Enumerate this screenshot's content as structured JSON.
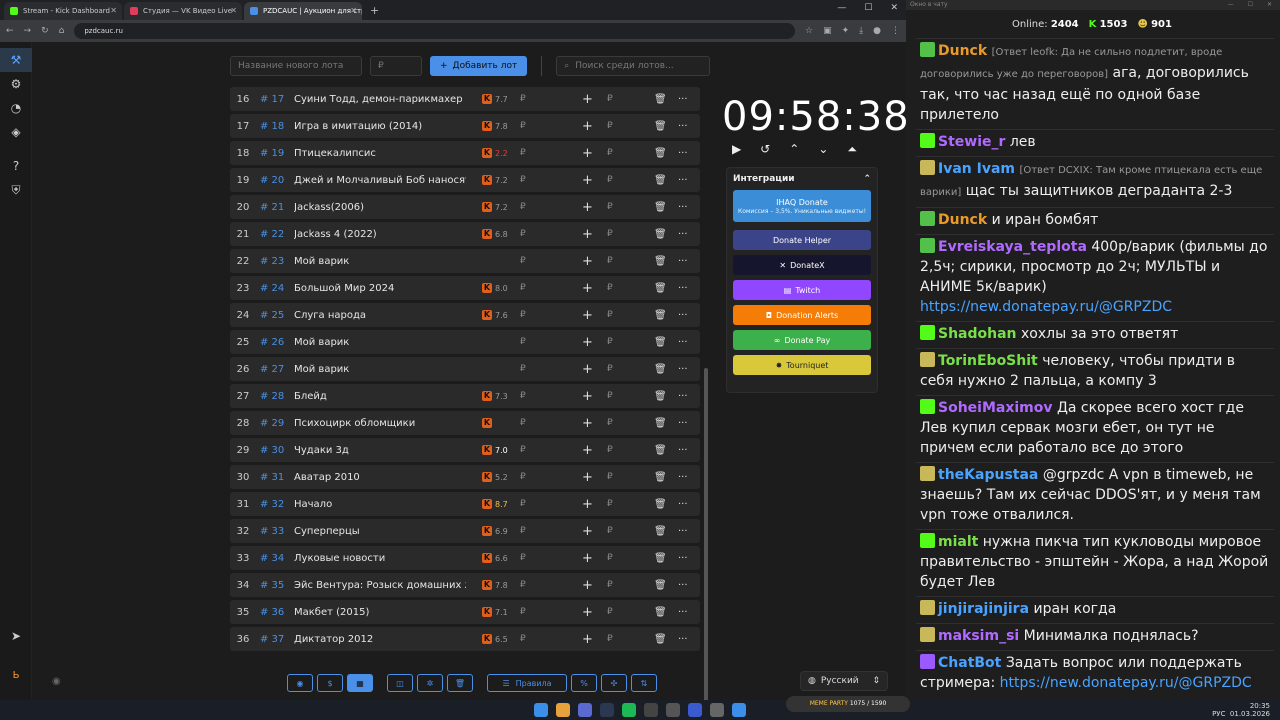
{
  "browser": {
    "tabs": [
      {
        "title": "Stream - Kick Dashboard",
        "color": "#53fc18"
      },
      {
        "title": "Студия — VK Видео Live",
        "color": "#e23c5b"
      },
      {
        "title": "PZDCAUC | Аукцион для стри",
        "color": "#4a8fe8"
      }
    ],
    "url": "pzdcauc.ru"
  },
  "sidebar": {
    "icons": [
      "auction-icon",
      "gear-icon",
      "pie-icon",
      "layers-icon",
      "help-icon",
      "shield-icon",
      "telegram-icon",
      "boosty-icon"
    ]
  },
  "controls": {
    "lot_placeholder": "Название нового лота",
    "amount_placeholder": "₽",
    "add_label": "Добавить лот",
    "search_placeholder": "Поиск среди лотов..."
  },
  "lots": [
    {
      "n": "16",
      "id": "# 17",
      "name": "Суини Тодд, демон-парикмахер с Ф",
      "rating": "7.7"
    },
    {
      "n": "17",
      "id": "# 18",
      "name": "Игра в имитацию (2014)",
      "rating": "7.8"
    },
    {
      "n": "18",
      "id": "# 19",
      "name": "Птицекалипсис",
      "rating": "2.2"
    },
    {
      "n": "19",
      "id": "# 20",
      "name": "Джей и Молчаливый Боб наносят о",
      "rating": "7.2"
    },
    {
      "n": "20",
      "id": "# 21",
      "name": "Jackass(2006)",
      "rating": "7.2"
    },
    {
      "n": "21",
      "id": "# 22",
      "name": "Jackass 4 (2022)",
      "rating": "6.8"
    },
    {
      "n": "22",
      "id": "# 23",
      "name": "Мой варик",
      "rating": ""
    },
    {
      "n": "23",
      "id": "# 24",
      "name": "Большой Мир 2024",
      "rating": "8.0"
    },
    {
      "n": "24",
      "id": "# 25",
      "name": "Слуга народа",
      "rating": "7.6"
    },
    {
      "n": "25",
      "id": "# 26",
      "name": "Мой варик",
      "rating": ""
    },
    {
      "n": "26",
      "id": "# 27",
      "name": "Мой варик",
      "rating": ""
    },
    {
      "n": "27",
      "id": "# 28",
      "name": "Блейд",
      "rating": "7.3"
    },
    {
      "n": "28",
      "id": "# 29",
      "name": "Психоцирк обломщики",
      "rating": ""
    },
    {
      "n": "29",
      "id": "# 30",
      "name": "Чудаки 3д",
      "rating": "7.0"
    },
    {
      "n": "30",
      "id": "# 31",
      "name": "Аватар 2010",
      "rating": "5.2"
    },
    {
      "n": "31",
      "id": "# 32",
      "name": "Начало",
      "rating": "8.7"
    },
    {
      "n": "32",
      "id": "# 33",
      "name": "Суперперцы",
      "rating": "6.9"
    },
    {
      "n": "33",
      "id": "# 34",
      "name": "Луковые новости",
      "rating": "6.6"
    },
    {
      "n": "34",
      "id": "# 35",
      "name": "Эйс Вентура: Розыск домашних жи",
      "rating": "7.8"
    },
    {
      "n": "35",
      "id": "# 36",
      "name": "Макбет (2015)",
      "rating": "7.1"
    },
    {
      "n": "36",
      "id": "# 37",
      "name": "Диктатор 2012",
      "rating": "6.5"
    }
  ],
  "timer": "09:58:38",
  "integrations": {
    "title": "Интеграции",
    "buttons": [
      {
        "label": "IHAQ Donate",
        "sub": "Комиссия – 3,5%. Уникальные виджеты!",
        "color": "#3a8dd6"
      },
      {
        "label": "Donate Helper",
        "color": "#3b4489"
      },
      {
        "label": "DonateX",
        "color": "#15162e"
      },
      {
        "label": "Twitch",
        "color": "#9146ff"
      },
      {
        "label": "Donation Alerts",
        "color": "#f57d07"
      },
      {
        "label": "Donate Pay",
        "color": "#3cb04a"
      },
      {
        "label": "Tourniquet",
        "color": "#d9c83a"
      }
    ]
  },
  "bottom": {
    "rules_label": "Правила",
    "language": "Русский"
  },
  "chat": {
    "window_title": "Окно в чату",
    "online_label": "Online:",
    "online": "2404",
    "kick_count": "1503",
    "other_count": "901",
    "messages": [
      {
        "user": "Dunck",
        "color": "#e89a2a",
        "badge": "#53c04a",
        "reply": "[Ответ leofk: Да не сильно подлетит, вроде договорились уже до переговоров]",
        "text": "ага, договорились так, что час назад ещё по одной базе прилетело"
      },
      {
        "user": "Stewie_r",
        "color": "#b06aff",
        "badge": "#53fc18",
        "reply": "",
        "text": "лев"
      },
      {
        "user": "Ivan Ivam",
        "color": "#4aa3ff",
        "badge": "#c8b85a",
        "reply": "[Ответ DCXIX: Там кроме птицекала есть еще варики]",
        "text": "щас ты защитников деграданта 2-3"
      },
      {
        "user": "Dunck",
        "color": "#e89a2a",
        "badge": "#53c04a",
        "reply": "",
        "text": "и иран бомбят"
      },
      {
        "user": "Evreiskaya_teplota",
        "color": "#b06aff",
        "badge": "#53c04a",
        "reply": "",
        "text": "400р/варик (фильмы до 2,5ч; сирики, просмотр до 2ч; МУЛЬТЫ и АНИМЕ 5к/варик)",
        "link": "https://new.donatepay.ru/@GRPZDC"
      },
      {
        "user": "Shadohan",
        "color": "#7ae04a",
        "badge": "#53fc18",
        "reply": "",
        "text": "хохлы за это ответят"
      },
      {
        "user": "TorinEboShit",
        "color": "#7ae04a",
        "badge": "#c8b85a",
        "reply": "",
        "text": "человеку, чтобы придти в себя нужно 2 пальца, а компу 3"
      },
      {
        "user": "SoheiMaximov",
        "color": "#b06aff",
        "badge": "#53fc18",
        "reply": "",
        "text": "Да скорее всего хост где Лев купил сервак мозги ебет, он тут не причем если работало все до этого"
      },
      {
        "user": "theKapustaa",
        "color": "#4aa3ff",
        "badge": "#c8b85a",
        "reply": "",
        "text": "@grpzdc А vpn в timeweb, не знаешь? Там их сейчас DDOS'ят, и у меня там vpn тоже отвалился."
      },
      {
        "user": "mialt",
        "color": "#7ae04a",
        "badge": "#53fc18",
        "reply": "",
        "text": "нужна пикча тип кукловоды мировое правительство - эпштейн - Жора, а над Жорой будет Лев"
      },
      {
        "user": "jinjirajinjira",
        "color": "#4aa3ff",
        "badge": "#c8b85a",
        "reply": "",
        "text": "иран когда"
      },
      {
        "user": "maksim_si",
        "color": "#b06aff",
        "badge": "#c8b85a",
        "reply": "",
        "text": "Минималка поднялась?"
      },
      {
        "user": "ChatBot",
        "color": "#4aa3ff",
        "badge": "#9a5aff",
        "reply": "",
        "text": "Задать вопрос или поддержать стримера:",
        "link": "https://new.donatepay.ru/@GRPZDC"
      }
    ]
  },
  "taskbar": {
    "lang": "РУС",
    "time": "20:35",
    "date": "01.03.2026",
    "meme": "MEME PARTY",
    "meme_count": "1075 / 1590"
  }
}
